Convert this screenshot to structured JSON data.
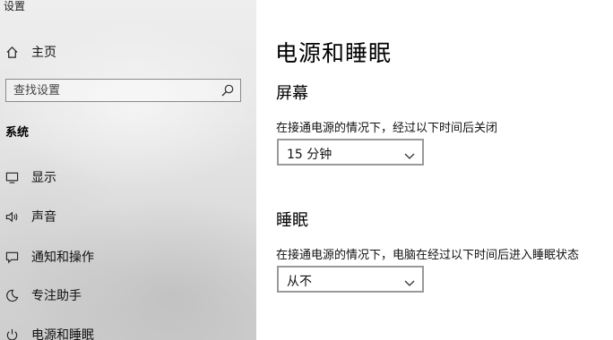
{
  "window": {
    "title": "设置"
  },
  "sidebar": {
    "home_label": "主页",
    "search_placeholder": "查找设置",
    "section_label": "系统",
    "items": [
      {
        "label": "显示",
        "icon": "monitor-icon"
      },
      {
        "label": "声音",
        "icon": "speaker-icon"
      },
      {
        "label": "通知和操作",
        "icon": "message-icon"
      },
      {
        "label": "专注助手",
        "icon": "moon-icon"
      },
      {
        "label": "电源和睡眠",
        "icon": "power-icon"
      }
    ]
  },
  "main": {
    "title": "电源和睡眠",
    "screen": {
      "heading": "屏幕",
      "description": "在接通电源的情况下，经过以下时间后关闭",
      "selected": "15 分钟"
    },
    "sleep": {
      "heading": "睡眠",
      "description": "在接通电源的情况下，电脑在经过以下时间后进入睡眠状态",
      "selected": "从不"
    }
  }
}
